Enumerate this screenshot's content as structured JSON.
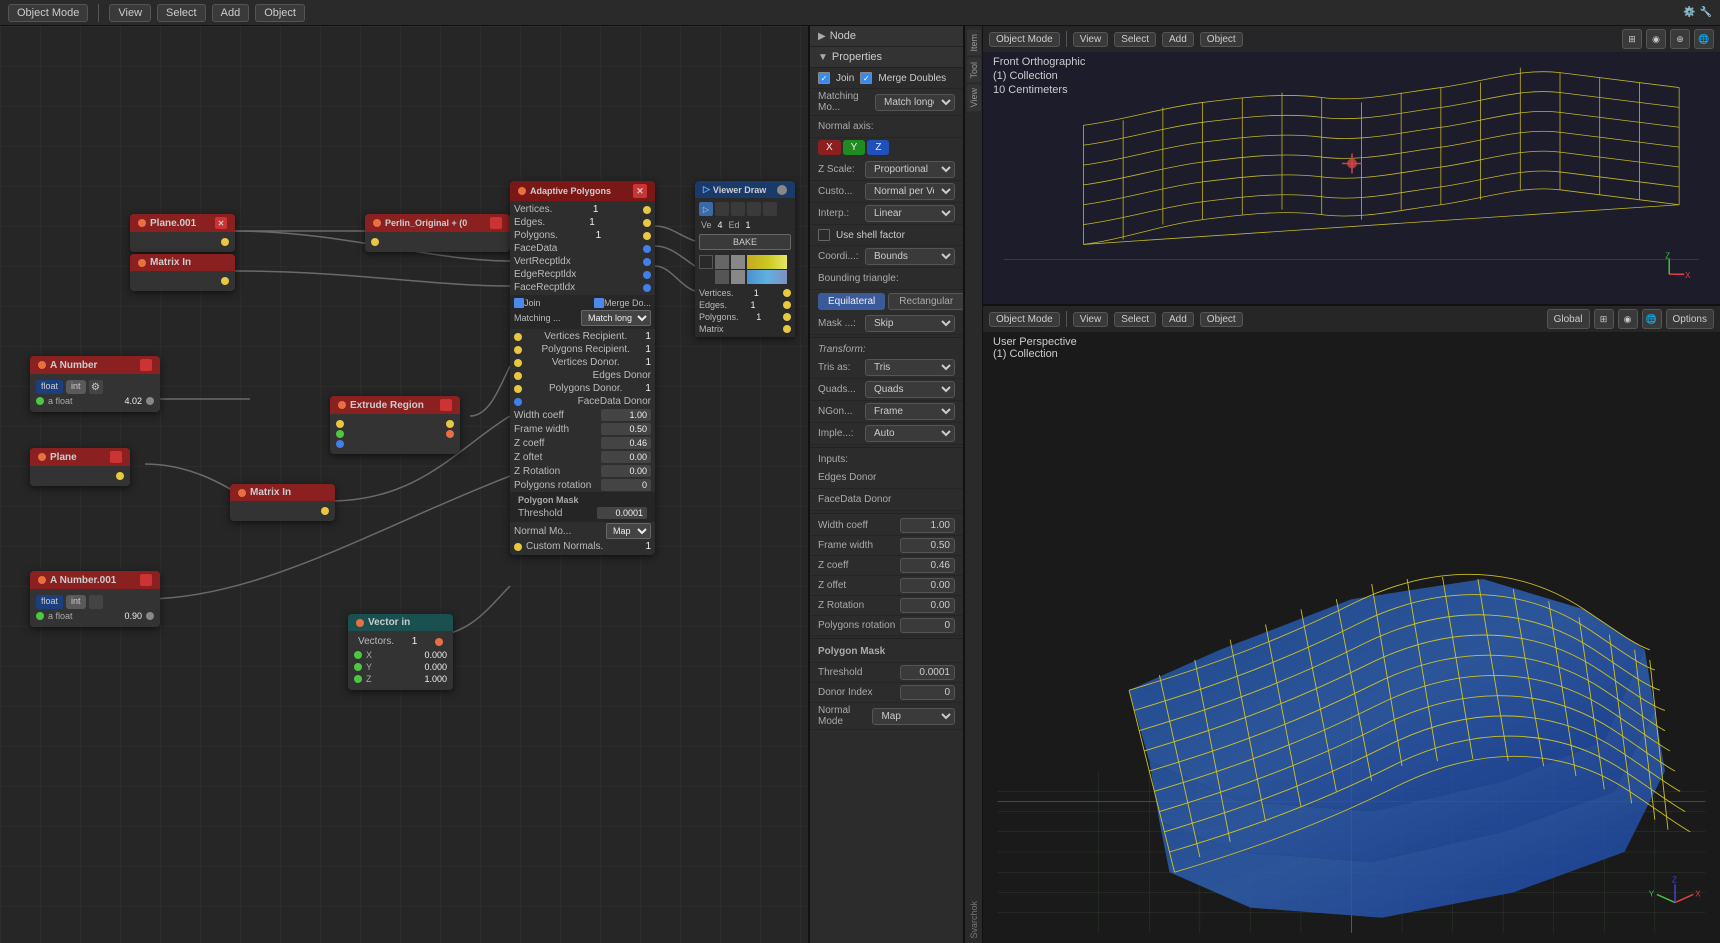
{
  "topbar": {
    "object_mode_label": "Object Mode",
    "view_label": "View",
    "select_label": "Select",
    "add_label": "Add",
    "object_label": "Object",
    "options_label": "Options"
  },
  "node_editor": {
    "nodes": {
      "plane001": {
        "label": "Plane.001"
      },
      "matrix_in1": {
        "label": "Matrix In"
      },
      "a_number": {
        "label": "A Number",
        "type_float": "float",
        "type_int": "int",
        "float_val": "4.02"
      },
      "a_number001": {
        "label": "A Number.001",
        "type_float": "float",
        "type_int": "int",
        "float_val": "0.90"
      },
      "plane": {
        "label": "Plane"
      },
      "extrude_region": {
        "label": "Extrude Region"
      },
      "matrix_in2": {
        "label": "Matrix In"
      },
      "perlin_original": {
        "label": "Perlin_Original + (0"
      },
      "adaptive_polygons": {
        "label": "Adaptive Polygons",
        "vertices_label": "Vertices.",
        "vertices_val": "1",
        "edges_label": "Edges.",
        "edges_val": "1",
        "polygons_label": "Polygons.",
        "polygons_val": "1",
        "facedata_label": "FaceData",
        "vertrecptldx_label": "VertRecptldx",
        "edgerecptldx_label": "EdgeRecptldx",
        "facerecptldx_label": "FaceRecptldx",
        "join_label": "Join",
        "merge_doubles_label": "Merge Do...",
        "matching_label": "Matching ...",
        "match_long_label": "Match long...",
        "vertices_recipient_label": "Vertices Recipient.",
        "vertices_recipient_val": "1",
        "polygons_recipient_label": "Polygons Recipient.",
        "polygons_recipient_val": "1",
        "vertices_donor_label": "Vertices Donor.",
        "vertices_donor_val": "1",
        "edges_donor_label": "Edges Donor",
        "polygons_donor_label": "Polygons Donor.",
        "polygons_donor_val": "1",
        "facedata_donor_label": "FaceData Donor",
        "width_coeff_label": "Width coeff",
        "width_coeff_val": "1.00",
        "frame_width_label": "Frame width",
        "frame_width_val": "0.50",
        "z_coeff_label": "Z coeff",
        "z_coeff_val": "0.46",
        "z_offset_label": "Z oftet",
        "z_offset_val": "0.00",
        "z_rotation_label": "Z Rotation",
        "z_rotation_val": "0.00",
        "polygons_rotation_label": "Polygons rotation",
        "polygons_rotation_val": "0",
        "polygon_mask_label": "Polygon Mask",
        "threshold_label": "Threshold",
        "threshold_val": "0.0001",
        "normal_mode_label": "Normal Mo...",
        "normal_mode_val": "Map",
        "custom_normals_label": "Custom Normals.",
        "custom_normals_val": "1"
      },
      "viewer_draw": {
        "label": "Viewer Draw",
        "ve_label": "Ve",
        "ve_val": "4",
        "ed_label": "Ed",
        "ed_val": "1",
        "bake_label": "BAKE",
        "vertices_label": "Vertices.",
        "vertices_val": "1",
        "edges_label": "Edges.",
        "edges_val": "1",
        "polygons_label": "Polygons.",
        "polygons_val": "1",
        "matrix_label": "Matrix"
      },
      "vector_in": {
        "label": "Vector in",
        "vectors_label": "Vectors.",
        "vectors_val": "1",
        "x_label": "X",
        "x_val": "0.000",
        "y_label": "Y",
        "y_val": "0.000",
        "z_label": "Z",
        "z_val": "1.000"
      }
    }
  },
  "properties": {
    "node_label": "Node",
    "properties_label": "Properties",
    "join_label": "Join",
    "merge_doubles_label": "Merge Doubles",
    "matching_mode_label": "Matching Mo...",
    "match_longest_label": "Match longest",
    "normal_axis_label": "Normal axis:",
    "x_label": "X",
    "y_label": "Y",
    "z_label": "Z",
    "z_scale_label": "Z Scale:",
    "proportional_label": "Proportional",
    "custom_label": "Custo...",
    "normal_per_vertex_label": "Normal per Vertex",
    "interp_label": "Interp.:",
    "linear_label": "Linear",
    "use_shell_factor_label": "Use shell factor",
    "coordi_label": "Coordi...:",
    "bounds_label": "Bounds",
    "bounding_triangle_label": "Bounding triangle:",
    "equilateral_label": "Equilateral",
    "rectangular_label": "Rectangular",
    "mask_label": "Mask ...:",
    "skip_label": "Skip",
    "transform_label": "Transform:",
    "tris_as_label": "Tris as:",
    "tris_label": "Tris",
    "quads_label": "Quads...",
    "quads_val": "Quads",
    "ngon_label": "NGon...",
    "ngon_val": "Frame",
    "imple_label": "Imple...:",
    "auto_label": "Auto",
    "inputs_label": "Inputs:",
    "edges_donor_label": "Edges Donor",
    "facedata_donor_label": "FaceData Donor",
    "width_coeff_label": "Width coeff",
    "width_coeff_val": "1.00",
    "frame_width_label": "Frame width",
    "frame_width_val": "0.50",
    "z_coeff_label": "Z coeff",
    "z_coeff_val": "0.46",
    "z_offset_label": "Z offet",
    "z_offset_val": "0.00",
    "z_rotation_label": "Z Rotation",
    "z_rotation_val": "0.00",
    "polygons_rotation_label": "Polygons rotation",
    "polygons_rotation_val": "0",
    "polygon_mask_label": "Polygon Mask",
    "threshold_label": "Threshold",
    "threshold_val": "0.0001",
    "donor_index_label": "Donor Index",
    "donor_index_val": "0",
    "normal_mode_label": "Normal Mode",
    "map_label": "Map"
  },
  "viewport_top": {
    "mode_label": "Object Mode",
    "view_label": "View",
    "select_label": "Select",
    "add_label": "Add",
    "object_label": "Object",
    "perspective_label": "Front Orthographic",
    "collection_label": "(1) Collection",
    "scale_label": "10 Centimeters"
  },
  "viewport_bottom": {
    "mode_label": "Object Mode",
    "view_label": "View",
    "select_label": "Select",
    "add_label": "Add",
    "object_label": "Object",
    "perspective_label": "User Perspective",
    "collection_label": "(1) Collection",
    "options_label": "Options"
  }
}
